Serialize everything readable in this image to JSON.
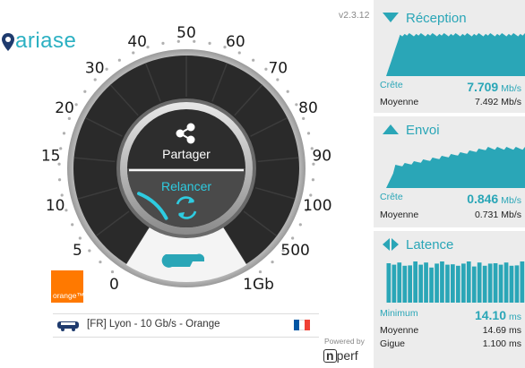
{
  "app": {
    "logo_text": "ariase",
    "version": "v2.3.12"
  },
  "gauge": {
    "scale_labels": [
      "0",
      "5",
      "10",
      "15",
      "20",
      "30",
      "40",
      "50",
      "60",
      "70",
      "80",
      "90",
      "100",
      "500",
      "1Gb"
    ],
    "share_label": "Partager",
    "restart_label": "Relancer",
    "progress": 0.12
  },
  "operator": {
    "logo_text": "orange™",
    "brand_color": "#ff7900"
  },
  "server": {
    "name": "[FR] Lyon - 10 Gb/s - Orange",
    "flag": "france"
  },
  "footer": {
    "powered_by": "Powered by",
    "brand": "n",
    "brand_suffix": "perf"
  },
  "colors": {
    "accent": "#2aa6b7",
    "panel_bg": "#ececec",
    "gauge_dark": "#2a2a2a"
  },
  "stats": {
    "reception": {
      "title": "Réception",
      "peak_label": "Crête",
      "peak_value": "7.709",
      "peak_unit": "Mb/s",
      "avg_label": "Moyenne",
      "avg_value": "7.492",
      "avg_unit": "Mb/s"
    },
    "upload": {
      "title": "Envoi",
      "peak_label": "Crête",
      "peak_value": "0.846",
      "peak_unit": "Mb/s",
      "avg_label": "Moyenne",
      "avg_value": "0.731",
      "avg_unit": "Mb/s"
    },
    "latency": {
      "title": "Latence",
      "min_label": "Minimum",
      "min_value": "14.10",
      "min_unit": "ms",
      "avg_label": "Moyenne",
      "avg_value": "14.69",
      "avg_unit": "ms",
      "jitter_label": "Gigue",
      "jitter_value": "1.100",
      "jitter_unit": "ms"
    }
  }
}
